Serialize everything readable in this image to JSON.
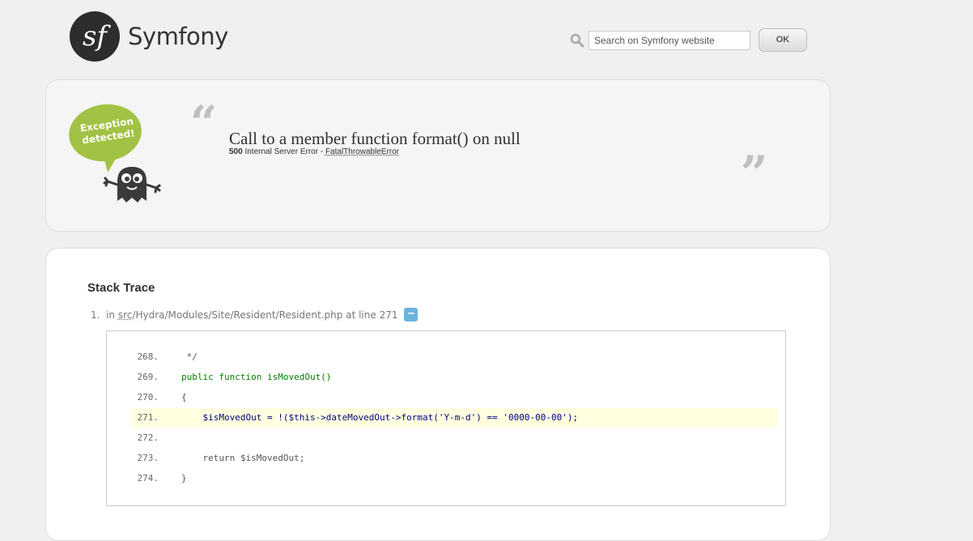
{
  "header": {
    "logo_text": "Symfony",
    "logo_glyph": "sf",
    "search": {
      "placeholder": "Search on Symfony website",
      "value": ""
    },
    "ok_label": "OK"
  },
  "exception": {
    "badge_text": "Exception detected!",
    "message": "Call to a member function format() on null",
    "status_code": "500",
    "status_text": "Internal Server Error - ",
    "exception_class": "FatalThrowableError"
  },
  "trace": {
    "title": "Stack Trace",
    "items": [
      {
        "number": "1.",
        "prefix": "in",
        "path_abbr": "src",
        "path_rest": "/Hydra/Modules/Site/Resident/Resident.php",
        "line_text": "at line 271",
        "toggle": "−"
      }
    ],
    "code": [
      {
        "ln": "268.",
        "text": " */"
      },
      {
        "ln": "269.",
        "text": "public function isMovedOut()"
      },
      {
        "ln": "270.",
        "text": "{"
      },
      {
        "ln": "271.",
        "text": "    $isMovedOut = !($this->dateMovedOut->format('Y-m-d') == '0000-00-00');"
      },
      {
        "ln": "272.",
        "text": ""
      },
      {
        "ln": "273.",
        "text": "    return $isMovedOut;"
      },
      {
        "ln": "274.",
        "text": "}"
      }
    ],
    "highlight_line": "271."
  },
  "colors": {
    "accent_green": "#a1c244",
    "toggle_blue": "#6bb3e0",
    "highlight_bg": "#ffffe0"
  }
}
